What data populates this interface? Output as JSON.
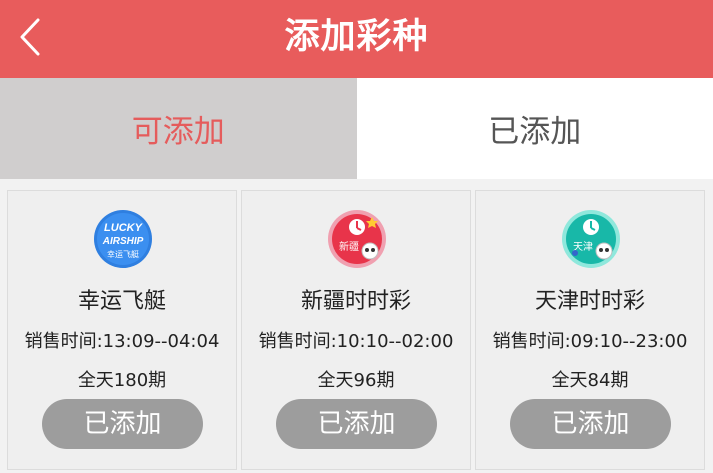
{
  "header": {
    "title": "添加彩种",
    "back_icon": "chevron-left-icon"
  },
  "tabs": [
    {
      "label": "可添加",
      "active": true
    },
    {
      "label": "已添加",
      "active": false
    }
  ],
  "colors": {
    "header_bg": "#e85c5c",
    "active_tab_bg": "#d0cece",
    "active_tab_text": "#e55c5c",
    "button_bg": "#9d9d9d"
  },
  "lotteries": [
    {
      "name": "幸运飞艇",
      "sales_time": "销售时间:13:09--04:04",
      "draws": "全天180期",
      "button": "已添加",
      "logo_text": [
        "LUCKY",
        "AIRSHIP",
        "幸运飞艇"
      ],
      "logo_icon": "lucky-airship-logo-icon"
    },
    {
      "name": "新疆时时彩",
      "sales_time": "销售时间:10:10--02:00",
      "draws": "全天96期",
      "button": "已添加",
      "logo_text": [
        "新疆"
      ],
      "logo_icon": "xinjiang-ssc-logo-icon"
    },
    {
      "name": "天津时时彩",
      "sales_time": "销售时间:09:10--23:00",
      "draws": "全天84期",
      "button": "已添加",
      "logo_text": [
        "天津"
      ],
      "logo_icon": "tianjin-ssc-logo-icon"
    }
  ]
}
